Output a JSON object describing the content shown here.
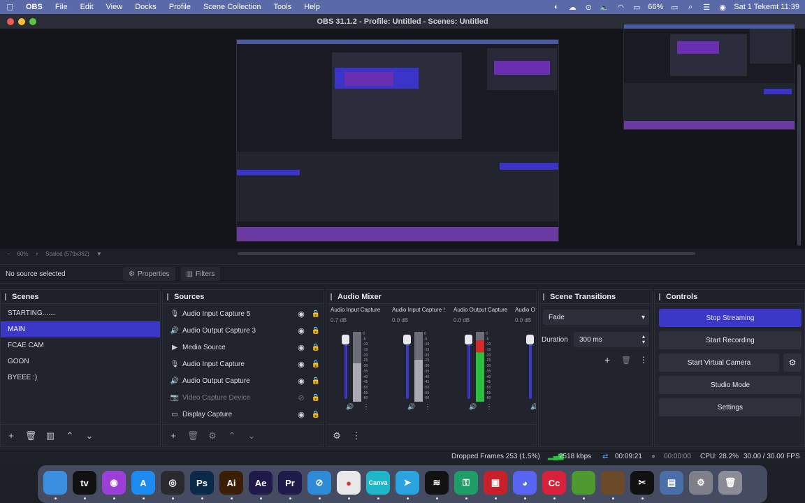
{
  "menubar": {
    "app": "OBS",
    "items": [
      "File",
      "Edit",
      "View",
      "Docks",
      "Profile",
      "Scene Collection",
      "Tools",
      "Help"
    ],
    "battery": "66%",
    "datetime": "Sat 1 Tekemt  11:39"
  },
  "window": {
    "title": "OBS 31.1.2 - Profile: Untitled - Scenes: Untitled"
  },
  "zoom": {
    "percent": "60%",
    "mode": "Scaled (579x362)"
  },
  "source_toolbar": {
    "no_source": "No source selected",
    "properties": "Properties",
    "filters": "Filters"
  },
  "scenes": {
    "title": "Scenes",
    "items": [
      "STARTING.......",
      "MAIN",
      "FCAE CAM",
      "GOON",
      "BYEEE :)"
    ],
    "active_index": 1
  },
  "sources": {
    "title": "Sources",
    "items": [
      {
        "name": "Audio Input Capture 5",
        "icon": "mic-icon"
      },
      {
        "name": "Audio Output Capture 3",
        "icon": "speaker-icon"
      },
      {
        "name": "Media Source",
        "icon": "play-icon"
      },
      {
        "name": "Audio Input Capture",
        "icon": "mic-icon"
      },
      {
        "name": "Audio Output Capture",
        "icon": "speaker-icon"
      },
      {
        "name": "Video Capture Device",
        "icon": "camera-icon"
      },
      {
        "name": "Display Capture",
        "icon": "monitor-icon"
      }
    ]
  },
  "mixer": {
    "title": "Audio Mixer",
    "channels": [
      {
        "name": "Audio Input Capture",
        "db": "0.7 dB",
        "level": 0.55
      },
      {
        "name": "Audio Input Capture !",
        "db": "0.0 dB",
        "level": 0.6
      },
      {
        "name": "Audio Output Capture",
        "db": "0.0 dB",
        "level": 0.88
      },
      {
        "name": "Audio O",
        "db": "0.0 dB",
        "level": 0.0
      }
    ],
    "ticks": [
      "0",
      "-5",
      "-10",
      "-15",
      "-20",
      "-25",
      "-30",
      "-35",
      "-40",
      "-45",
      "-50",
      "-55",
      "-60"
    ]
  },
  "transitions": {
    "title": "Scene Transitions",
    "type": "Fade",
    "duration_label": "Duration",
    "duration": "300 ms"
  },
  "controls": {
    "title": "Controls",
    "stop_streaming": "Stop Streaming",
    "start_recording": "Start Recording",
    "start_virtual_camera": "Start Virtual Camera",
    "studio_mode": "Studio Mode",
    "settings": "Settings"
  },
  "status": {
    "dropped": "Dropped Frames 253 (1.5%)",
    "bitrate": "2518 kbps",
    "stream_time": "00:09:21",
    "rec_time": "00:00:00",
    "cpu": "CPU: 28.2%",
    "fps": "30.00 / 30.00 FPS"
  },
  "colors": {
    "accent": "#3b38c7",
    "menubar": "#5a6aa8",
    "bg": "#1d1f27",
    "meter_green": "#2bbf3e",
    "meter_red": "#d32a2a"
  },
  "dock_apps": [
    {
      "name": "finder-icon",
      "label": "",
      "color": "#3a8fe0"
    },
    {
      "name": "apple-tv-icon",
      "label": "tv",
      "color": "#111111"
    },
    {
      "name": "podcasts-icon",
      "label": "◉",
      "color": "#9b3fd6"
    },
    {
      "name": "app-store-icon",
      "label": "A",
      "color": "#1d8cf0"
    },
    {
      "name": "obs-icon",
      "label": "◎",
      "color": "#2a2a2e"
    },
    {
      "name": "photoshop-icon",
      "label": "Ps",
      "color": "#0b2a4a"
    },
    {
      "name": "illustrator-icon",
      "label": "Ai",
      "color": "#3a1e06"
    },
    {
      "name": "after-effects-icon",
      "label": "Ae",
      "color": "#1f1a4a"
    },
    {
      "name": "premiere-icon",
      "label": "Pr",
      "color": "#1e1a4a"
    },
    {
      "name": "safari-icon",
      "label": "⊘",
      "color": "#2f8ad8"
    },
    {
      "name": "chrome-icon",
      "label": "●",
      "color": "#e8e8e8"
    },
    {
      "name": "canva-icon",
      "label": "Canva",
      "color": "#1fb6c9"
    },
    {
      "name": "telegram-icon",
      "label": "➤",
      "color": "#2aa3de"
    },
    {
      "name": "spotify-icon",
      "label": "≋",
      "color": "#121212"
    },
    {
      "name": "key-icon",
      "label": "⚿",
      "color": "#1e9e66"
    },
    {
      "name": "toolbox-icon",
      "label": "▣",
      "color": "#c8202a"
    },
    {
      "name": "discord-icon",
      "label": "◕",
      "color": "#5865f2"
    },
    {
      "name": "creative-cloud-icon",
      "label": "Cc",
      "color": "#d8213b"
    },
    {
      "name": "minecraft-grass-icon",
      "label": "",
      "color": "#4e9a2f"
    },
    {
      "name": "minecraft-icon",
      "label": "",
      "color": "#6b4a2a"
    },
    {
      "name": "capcut-icon",
      "label": "✂",
      "color": "#111111"
    },
    {
      "name": "preview-icon",
      "label": "▤",
      "color": "#4a6fa8"
    },
    {
      "name": "settings-icon",
      "label": "⚙",
      "color": "#7e7f88"
    },
    {
      "name": "trash-icon",
      "label": "🗑",
      "color": "#8b8c96"
    }
  ]
}
